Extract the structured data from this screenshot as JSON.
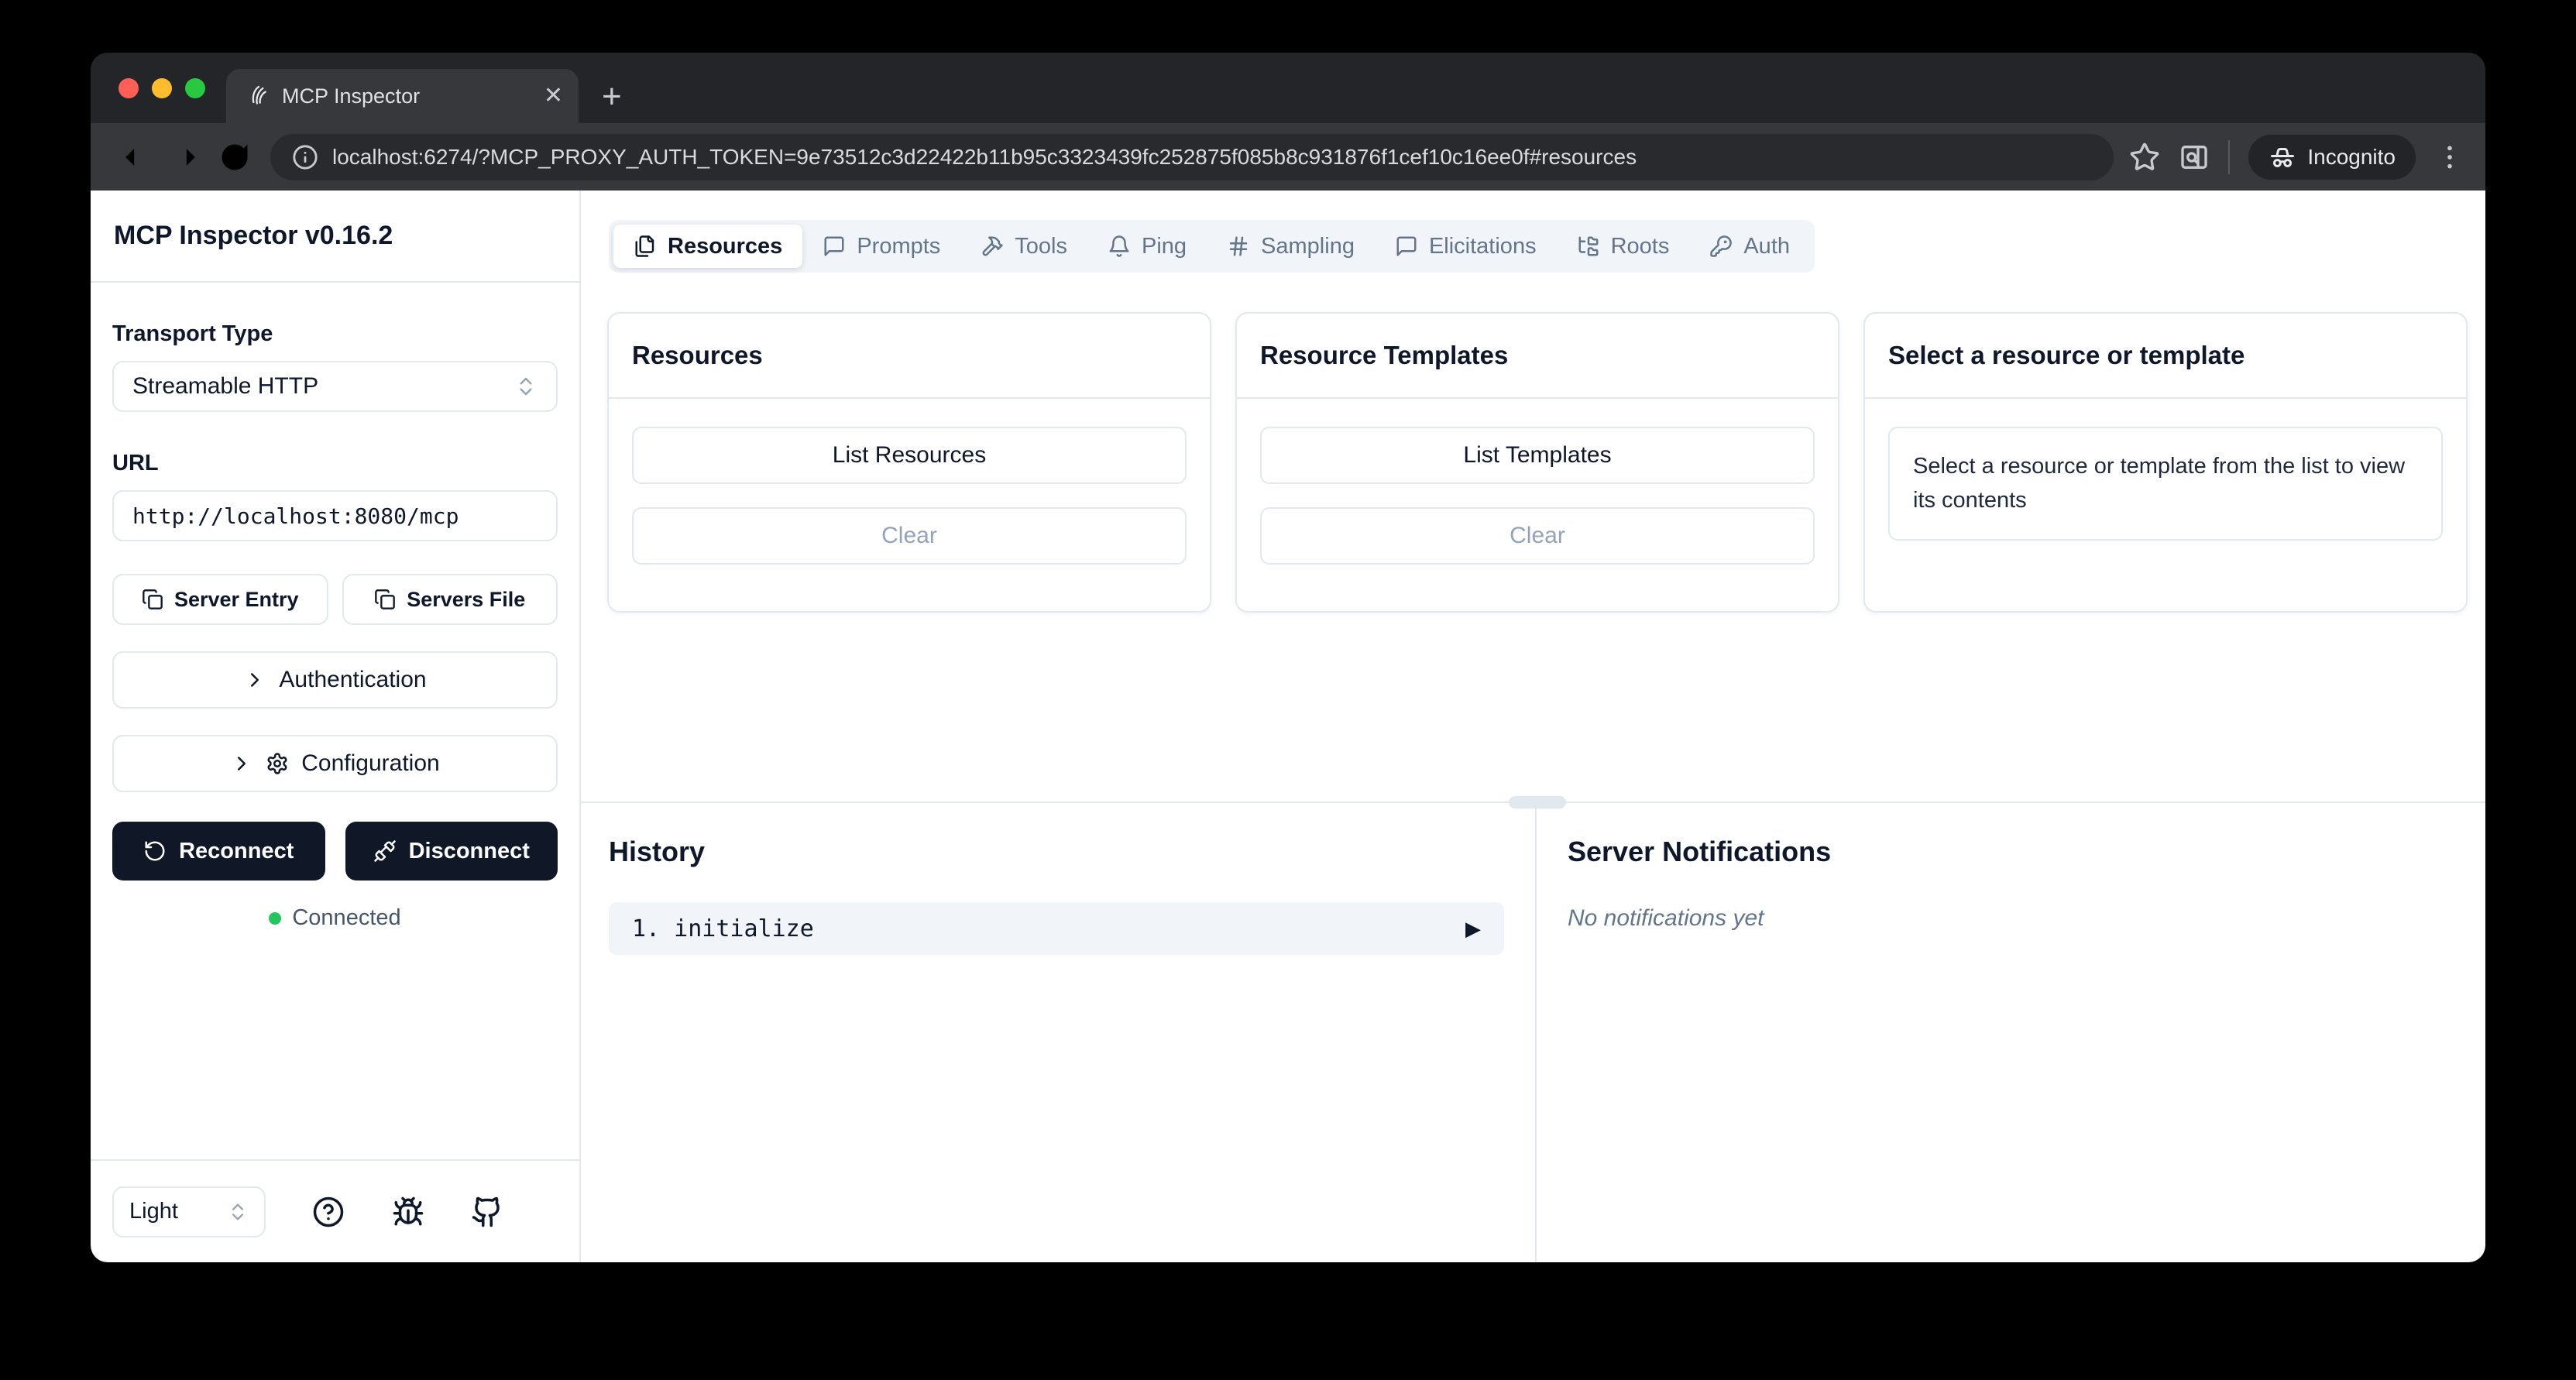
{
  "browser": {
    "tab_title": "MCP Inspector",
    "close_glyph": "✕",
    "new_tab_glyph": "+",
    "url": "localhost:6274/?MCP_PROXY_AUTH_TOKEN=9e73512c3d22422b11b95c3323439fc252875f085b8c931876f1cef10c16ee0f#resources",
    "incognito_label": "Incognito"
  },
  "sidebar": {
    "title": "MCP Inspector v0.16.2",
    "transport_type_label": "Transport Type",
    "transport_type_value": "Streamable HTTP",
    "url_label": "URL",
    "url_value": "http://localhost:8080/mcp",
    "server_entry_label": "Server Entry",
    "servers_file_label": "Servers File",
    "authentication_label": "Authentication",
    "configuration_label": "Configuration",
    "reconnect_label": "Reconnect",
    "disconnect_label": "Disconnect",
    "status_connected": "Connected",
    "theme_value": "Light"
  },
  "tabs": [
    {
      "label": "Resources",
      "icon": "files-icon",
      "active": true
    },
    {
      "label": "Prompts",
      "icon": "message-square-icon",
      "active": false
    },
    {
      "label": "Tools",
      "icon": "hammer-icon",
      "active": false
    },
    {
      "label": "Ping",
      "icon": "bell-icon",
      "active": false
    },
    {
      "label": "Sampling",
      "icon": "hash-icon",
      "active": false
    },
    {
      "label": "Elicitations",
      "icon": "message-square-icon",
      "active": false
    },
    {
      "label": "Roots",
      "icon": "folder-tree-icon",
      "active": false
    },
    {
      "label": "Auth",
      "icon": "key-icon",
      "active": false
    }
  ],
  "panels": {
    "resources": {
      "title": "Resources",
      "list_button": "List Resources",
      "clear_button": "Clear"
    },
    "templates": {
      "title": "Resource Templates",
      "list_button": "List Templates",
      "clear_button": "Clear"
    },
    "detail": {
      "title": "Select a resource or template",
      "placeholder": "Select a resource or template from the list to view its contents"
    }
  },
  "history": {
    "title": "History",
    "items": [
      {
        "text": "1. initialize",
        "expand_glyph": "▶"
      }
    ]
  },
  "notifications": {
    "title": "Server Notifications",
    "empty": "No notifications yet"
  },
  "colors": {
    "border": "#e2e8f0",
    "dark_button": "#101828",
    "connected_green": "#22c55e",
    "tabbar_bg": "#f1f5f9"
  }
}
